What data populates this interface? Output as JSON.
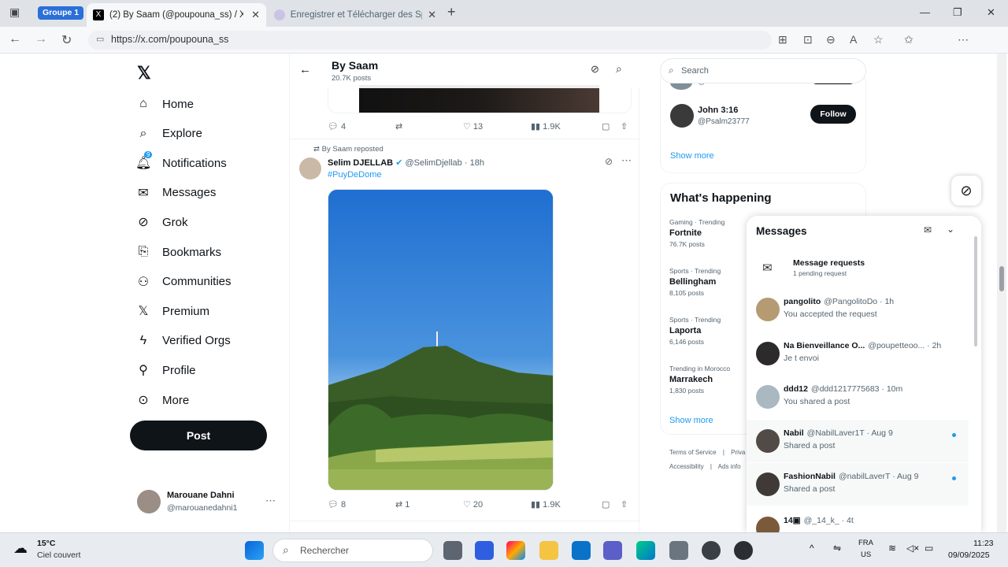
{
  "browser": {
    "group_label": "Groupe 1",
    "tabs": [
      {
        "title": "(2) By Saam (@poupouna_ss) / X"
      },
      {
        "title": "Enregistrer et Télécharger des Sp"
      }
    ],
    "new_tab": "+",
    "url": "https://x.com/poupouna_ss"
  },
  "sidebar": {
    "items": [
      {
        "label": "Home",
        "icon": "home-icon"
      },
      {
        "label": "Explore",
        "icon": "search-icon"
      },
      {
        "label": "Notifications",
        "icon": "bell-icon",
        "badge": "9"
      },
      {
        "label": "Messages",
        "icon": "mail-icon"
      },
      {
        "label": "Grok",
        "icon": "grok-icon"
      },
      {
        "label": "Bookmarks",
        "icon": "bookmark-icon"
      },
      {
        "label": "Communities",
        "icon": "people-icon"
      },
      {
        "label": "Premium",
        "icon": "x-icon"
      },
      {
        "label": "Verified Orgs",
        "icon": "bolt-icon"
      },
      {
        "label": "Profile",
        "icon": "person-icon"
      },
      {
        "label": "More",
        "icon": "more-circle-icon"
      }
    ],
    "post_button": "Post",
    "account": {
      "name": "Marouane Dahni",
      "handle": "@marouanedahni1"
    }
  },
  "feed": {
    "header": {
      "title": "By Saam",
      "subtitle": "20.7K posts"
    },
    "prev_post_stats": {
      "replies": "4",
      "likes": "13",
      "views": "1.9K"
    },
    "post": {
      "repost_label": "By Saam reposted",
      "author": "Selim DJELLAB",
      "handle": "@SelimDjellab",
      "time": "· 18h",
      "hashtag": "#PuyDeDome",
      "stats": {
        "replies": "8",
        "reposts": "1",
        "likes": "20",
        "views": "1.9K"
      }
    }
  },
  "right": {
    "search_placeholder": "Search",
    "who_to_follow": [
      {
        "handle": "@Baoduo1314"
      },
      {
        "name": "John 3:16",
        "handle": "@Psalm23777",
        "action": "Follow"
      }
    ],
    "show_more": "Show more",
    "whats_happening": {
      "title": "What's happening",
      "trends": [
        {
          "category": "Gaming · Trending",
          "name": "Fortnite",
          "count": "76.7K posts"
        },
        {
          "category": "Sports · Trending",
          "name": "Bellingham",
          "count": "8,105 posts"
        },
        {
          "category": "Sports · Trending",
          "name": "Laporta",
          "count": "6,146 posts"
        },
        {
          "category": "Trending in Morocco",
          "name": "Marrakech",
          "count": "1,830 posts"
        }
      ],
      "show_more": "Show more"
    },
    "footer": {
      "terms": "Terms of Service",
      "sep": "|",
      "privacy": "Priva",
      "accessibility": "Accessibility",
      "ads": "Ads info"
    }
  },
  "messages": {
    "title": "Messages",
    "request": {
      "title": "Message requests",
      "subtitle": "1 pending request"
    },
    "items": [
      {
        "name": "pangolito",
        "handle": "@PangolitoDo · 1h",
        "preview": "You accepted the request",
        "color": "#b59a72"
      },
      {
        "name": "Na Bienveillance O...",
        "handle": "@poupetteoo... · 2h",
        "preview": "Je t envoi",
        "color": "#2c2a2a"
      },
      {
        "name": "ddd12",
        "handle": "@ddd1217775683 · 10m",
        "preview": "You shared a post",
        "color": "#aab8c2"
      },
      {
        "name": "Nabil",
        "handle": "@NabilLaver1T · Aug 9",
        "preview": "Shared a post",
        "color": "#524a46",
        "unread": true
      },
      {
        "name": "FashionNabil",
        "handle": "@nabilLaverT · Aug 9",
        "preview": "Shared a post",
        "color": "#3f3a38",
        "unread": true
      },
      {
        "name": "14▣",
        "handle": "@_14_k_ · 4t",
        "preview": "",
        "color": "#7a5a3a"
      }
    ]
  },
  "taskbar": {
    "weather_temp": "15°C",
    "weather_desc": "Ciel couvert",
    "search_placeholder": "Rechercher",
    "lang_top": "FRA",
    "lang_bottom": "US",
    "time": "11:23",
    "date": "09/09/2025"
  }
}
